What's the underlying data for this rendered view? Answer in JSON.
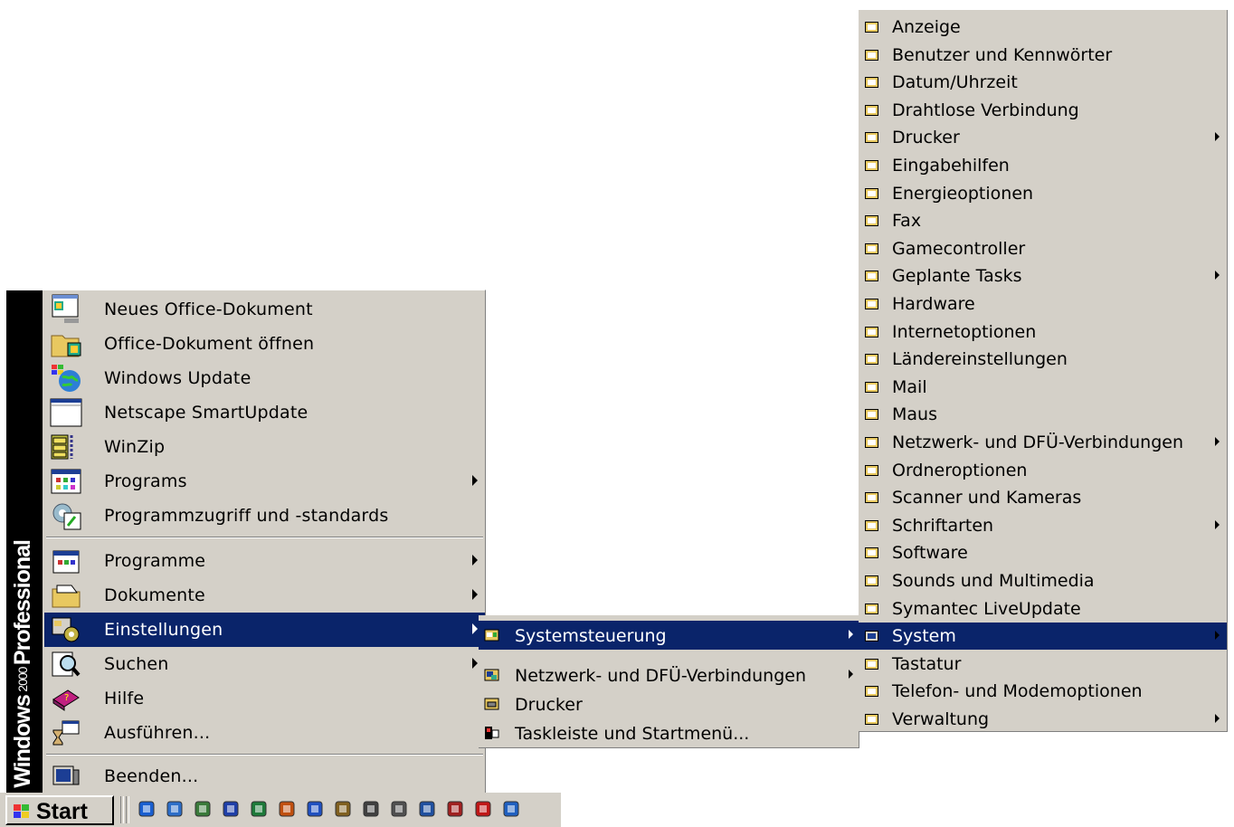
{
  "banner": {
    "line1": "Windows",
    "line2": "2000",
    "line3": "Professional"
  },
  "start_menu": {
    "top_items": [
      {
        "label": "Neues Office-Dokument",
        "icon": "new-office-document-icon",
        "submenu": false
      },
      {
        "label": "Office-Dokument öffnen",
        "icon": "open-office-document-icon",
        "submenu": false
      },
      {
        "label": "Windows Update",
        "icon": "windows-update-globe-icon",
        "submenu": false
      },
      {
        "label": "Netscape SmartUpdate",
        "icon": "netscape-window-icon",
        "submenu": false
      },
      {
        "label": "WinZip",
        "icon": "winzip-cabinet-icon",
        "submenu": false
      },
      {
        "label": "Programs",
        "icon": "program-group-icon",
        "submenu": true
      },
      {
        "label": "Programmzugriff und -standards",
        "icon": "program-access-icon",
        "submenu": false
      }
    ],
    "main_items": [
      {
        "label": "Programme",
        "icon": "programs-folder-icon",
        "submenu": true
      },
      {
        "label": "Dokumente",
        "icon": "documents-folder-icon",
        "submenu": true
      },
      {
        "label": "Einstellungen",
        "icon": "settings-icon",
        "submenu": true,
        "selected": true
      },
      {
        "label": "Suchen",
        "icon": "search-magnifier-icon",
        "submenu": true
      },
      {
        "label": "Hilfe",
        "icon": "help-book-icon",
        "submenu": false
      },
      {
        "label": "Ausführen...",
        "icon": "run-icon",
        "submenu": false
      }
    ],
    "shutdown_item": {
      "label": "Beenden...",
      "icon": "shutdown-computer-icon"
    }
  },
  "settings_submenu": [
    {
      "label": "Systemsteuerung",
      "icon": "control-panel-icon",
      "submenu": true,
      "selected": true
    },
    {
      "label": "Netzwerk- und DFÜ-Verbindungen",
      "icon": "network-connections-icon",
      "submenu": true
    },
    {
      "label": "Drucker",
      "icon": "printer-folder-icon",
      "submenu": false
    },
    {
      "label": "Taskleiste und Startmenü...",
      "icon": "taskbar-icon",
      "submenu": false
    }
  ],
  "control_panel_submenu": [
    {
      "label": "Anzeige",
      "icon": "display-icon",
      "submenu": false
    },
    {
      "label": "Benutzer und Kennwörter",
      "icon": "users-icon",
      "submenu": false
    },
    {
      "label": "Datum/Uhrzeit",
      "icon": "calendar-clock-icon",
      "submenu": false
    },
    {
      "label": "Drahtlose Verbindung",
      "icon": "wireless-icon",
      "submenu": false
    },
    {
      "label": "Drucker",
      "icon": "printer-icon",
      "submenu": true
    },
    {
      "label": "Eingabehilfen",
      "icon": "accessibility-icon",
      "submenu": false
    },
    {
      "label": "Energieoptionen",
      "icon": "power-options-icon",
      "submenu": false
    },
    {
      "label": "Fax",
      "icon": "fax-icon",
      "submenu": false
    },
    {
      "label": "Gamecontroller",
      "icon": "game-controller-icon",
      "submenu": false
    },
    {
      "label": "Geplante Tasks",
      "icon": "scheduled-tasks-icon",
      "submenu": true
    },
    {
      "label": "Hardware",
      "icon": "hardware-icon",
      "submenu": false
    },
    {
      "label": "Internetoptionen",
      "icon": "internet-options-icon",
      "submenu": false
    },
    {
      "label": "Ländereinstellungen",
      "icon": "regional-settings-globe-icon",
      "submenu": false
    },
    {
      "label": "Mail",
      "icon": "mail-icon",
      "submenu": false
    },
    {
      "label": "Maus",
      "icon": "mouse-icon",
      "submenu": false
    },
    {
      "label": "Netzwerk- und DFÜ-Verbindungen",
      "icon": "network-connections-icon",
      "submenu": true
    },
    {
      "label": "Ordneroptionen",
      "icon": "folder-options-icon",
      "submenu": false
    },
    {
      "label": "Scanner und Kameras",
      "icon": "scanner-camera-icon",
      "submenu": false
    },
    {
      "label": "Schriftarten",
      "icon": "fonts-folder-icon",
      "submenu": true
    },
    {
      "label": "Software",
      "icon": "software-icon",
      "submenu": false
    },
    {
      "label": "Sounds und Multimedia",
      "icon": "speaker-icon",
      "submenu": false
    },
    {
      "label": "Symantec LiveUpdate",
      "icon": "symantec-liveupdate-icon",
      "submenu": false
    },
    {
      "label": "System",
      "icon": "system-computer-icon",
      "submenu": true,
      "selected": true
    },
    {
      "label": "Tastatur",
      "icon": "keyboard-icon",
      "submenu": false
    },
    {
      "label": "Telefon- und Modemoptionen",
      "icon": "phone-modem-icon",
      "submenu": false
    },
    {
      "label": "Verwaltung",
      "icon": "administration-icon",
      "submenu": true
    }
  ],
  "taskbar": {
    "start_label": "Start",
    "quick_launch": [
      {
        "icon": "internet-explorer-icon",
        "color": "#1a5fd0"
      },
      {
        "icon": "outlook-express-icon",
        "color": "#2d6ec8"
      },
      {
        "icon": "refresh-arrows-icon",
        "color": "#3a7a3a"
      },
      {
        "icon": "word-icon",
        "color": "#1f3fa8"
      },
      {
        "icon": "excel-icon",
        "color": "#1e7a3a"
      },
      {
        "icon": "powerpoint-icon",
        "color": "#c05010"
      },
      {
        "icon": "wordpad-icon",
        "color": "#2050c0"
      },
      {
        "icon": "search-icon",
        "color": "#806020"
      },
      {
        "icon": "printer-quick-icon",
        "color": "#404040"
      },
      {
        "icon": "keyboard-quick-icon",
        "color": "#505050"
      },
      {
        "icon": "desktop-icon",
        "color": "#2050a0"
      },
      {
        "icon": "network-quick-icon",
        "color": "#a02020"
      },
      {
        "icon": "acrobat-icon",
        "color": "#c01818"
      },
      {
        "icon": "quicktime-icon",
        "color": "#2060c0"
      }
    ]
  },
  "colors": {
    "menu_bg": "#d4d0c8",
    "highlight": "#0a246a",
    "banner": "#000000"
  }
}
